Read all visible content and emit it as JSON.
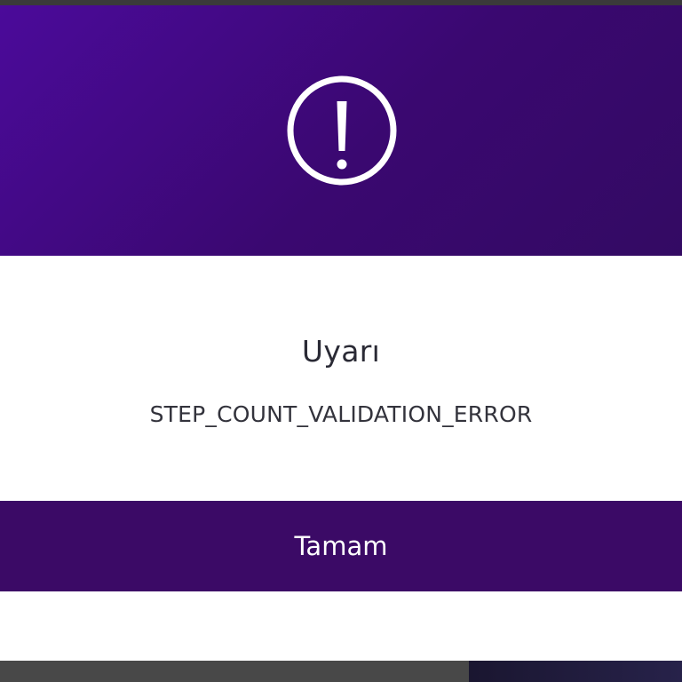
{
  "dialog": {
    "icon": "exclamation-circle-icon",
    "title": "Uyarı",
    "message": "STEP_COUNT_VALIDATION_ERROR",
    "confirm_label": "Tamam"
  },
  "colors": {
    "header_start": "#4b0a9a",
    "header_end": "#330a63",
    "button_bg": "#3b0a66",
    "button_text": "#ffffff",
    "title_text": "#2a2a35"
  }
}
